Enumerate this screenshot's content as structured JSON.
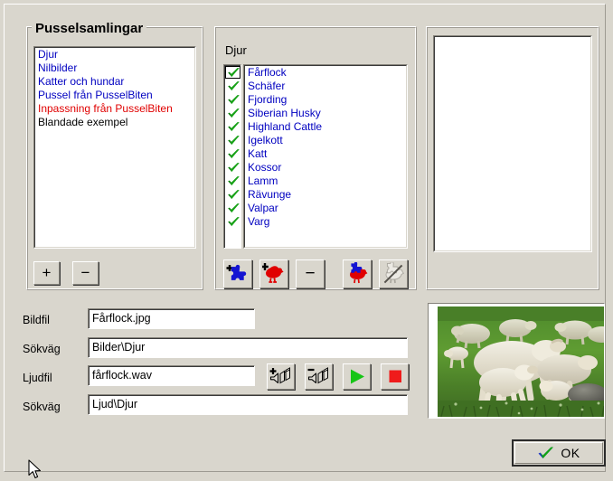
{
  "window": {
    "background_color": "#d9d6cd"
  },
  "collections_group": {
    "title": "Pusselsamlingar",
    "items": [
      {
        "label": "Djur",
        "color": "#0000c0"
      },
      {
        "label": "Nilbilder",
        "color": "#0000c0"
      },
      {
        "label": "Katter och hundar",
        "color": "#0000c0"
      },
      {
        "label": "Pussel från PusselBiten",
        "color": "#0000c0"
      },
      {
        "label": "Inpassning från PusselBiten",
        "color": "#e00000"
      },
      {
        "label": "Blandade exempel",
        "color": "#000000"
      }
    ],
    "add_button": "+",
    "remove_button": "−"
  },
  "animals_group": {
    "title": "Djur",
    "items": [
      {
        "label": "Fårflock",
        "checked": true,
        "focused": true
      },
      {
        "label": "Schäfer",
        "checked": true,
        "focused": false
      },
      {
        "label": "Fjording",
        "checked": true,
        "focused": false
      },
      {
        "label": "Siberian Husky",
        "checked": true,
        "focused": false
      },
      {
        "label": "Highland Cattle",
        "checked": true,
        "focused": false
      },
      {
        "label": "Igelkott",
        "checked": true,
        "focused": false
      },
      {
        "label": "Katt",
        "checked": true,
        "focused": false
      },
      {
        "label": "Kossor",
        "checked": true,
        "focused": false
      },
      {
        "label": "Lamm",
        "checked": true,
        "focused": false
      },
      {
        "label": "Rävunge",
        "checked": true,
        "focused": false
      },
      {
        "label": "Valpar",
        "checked": true,
        "focused": false
      },
      {
        "label": "Varg",
        "checked": true,
        "focused": false
      }
    ],
    "item_color": "#0000c0",
    "buttons": [
      {
        "name": "add-puzzle-button",
        "icon": "add-puzzle-icon",
        "enabled": true
      },
      {
        "name": "add-animal-button",
        "icon": "add-bird-icon",
        "enabled": true
      },
      {
        "name": "remove-item-button",
        "icon": "minus-icon",
        "label": "−",
        "enabled": true
      },
      {
        "name": "assign-puzzle-button",
        "icon": "bird-puzzle-icon",
        "enabled": true
      },
      {
        "name": "unassign-puzzle-button",
        "icon": "bird-puzzle-disabled-icon",
        "enabled": false
      }
    ]
  },
  "third_group": {
    "title": ""
  },
  "fields": {
    "image_file": {
      "label": "Bildfil",
      "value": "Fårflock.jpg",
      "placeholder": ""
    },
    "image_path": {
      "label": "Sökväg",
      "value": "Bilder\\Djur",
      "placeholder": ""
    },
    "sound_file": {
      "label": "Ljudfil",
      "value": "fårflock.wav",
      "placeholder": ""
    },
    "sound_path": {
      "label": "Sökväg",
      "value": "Ljud\\Djur",
      "placeholder": ""
    }
  },
  "media_buttons": [
    {
      "name": "add-sound-button",
      "icon": "speaker-plus-icon"
    },
    {
      "name": "remove-sound-button",
      "icon": "speaker-minus-icon"
    },
    {
      "name": "play-button",
      "icon": "play-icon",
      "color": "#00c000"
    },
    {
      "name": "stop-button",
      "icon": "stop-icon",
      "color": "#e00000"
    }
  ],
  "preview": {
    "name": "image-preview",
    "alt": "Fårflock"
  },
  "ok_button": {
    "label": "OK",
    "icon": "check-icon"
  }
}
